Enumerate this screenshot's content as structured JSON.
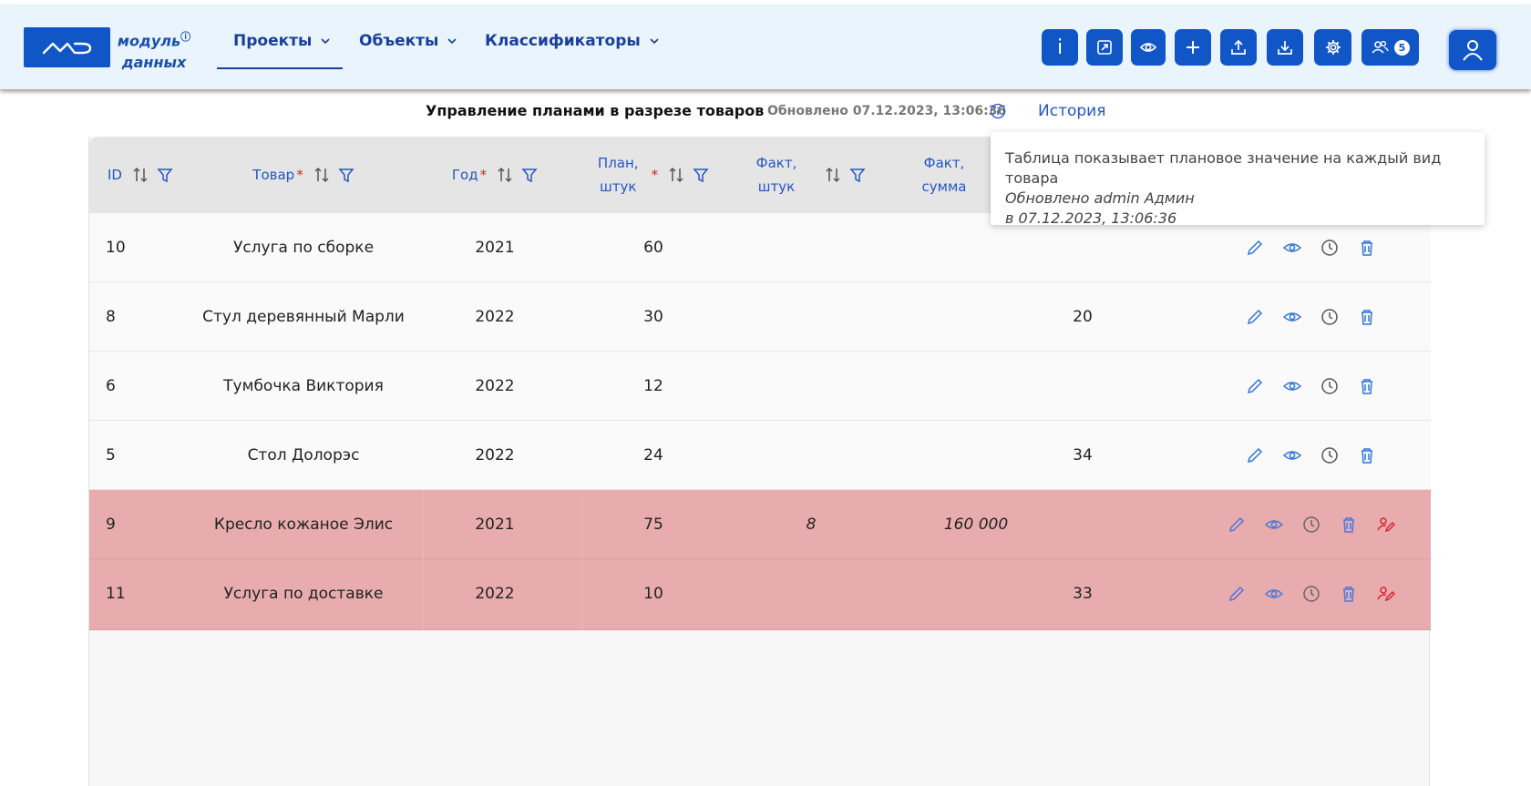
{
  "logo": {
    "line1": "модуль",
    "line2": "данных",
    "info": "i"
  },
  "nav": [
    {
      "label": "Проекты"
    },
    {
      "label": "Объекты"
    },
    {
      "label": "Классификаторы"
    }
  ],
  "toolbar": {
    "i_label": "i",
    "users_badge": "5"
  },
  "page": {
    "title": "Управление планами в разрезе товаров",
    "updated": "Обновлено 07.12.2023, 13:06:36",
    "history": "История"
  },
  "table": {
    "headers": {
      "id": "ID",
      "product": "Товар",
      "year": "Год",
      "plan_l1": "План,",
      "plan_l2": "штук",
      "fact_qty_l1": "Факт,",
      "fact_qty_l2": "штук",
      "fact_sum_l1": "Факт,",
      "fact_sum_l2": "сумма",
      "required_mark": "*"
    },
    "rows": [
      {
        "id": "10",
        "product": "Услуга по сборке",
        "year": "2021",
        "plan": "60",
        "fact_qty": "",
        "fact_sum": "",
        "extra": ""
      },
      {
        "id": "8",
        "product": "Стул деревянный Марли",
        "year": "2022",
        "plan": "30",
        "fact_qty": "",
        "fact_sum": "",
        "extra": "20"
      },
      {
        "id": "6",
        "product": "Тумбочка Виктория",
        "year": "2022",
        "plan": "12",
        "fact_qty": "",
        "fact_sum": "",
        "extra": ""
      },
      {
        "id": "5",
        "product": "Стол Долорэс",
        "year": "2022",
        "plan": "24",
        "fact_qty": "",
        "fact_sum": "",
        "extra": "34"
      },
      {
        "id": "9",
        "product": "Кресло кожаное Элис",
        "year": "2021",
        "plan": "75",
        "fact_qty": "8",
        "fact_sum": "160 000",
        "extra": ""
      },
      {
        "id": "11",
        "product": "Услуга по доставке",
        "year": "2022",
        "plan": "10",
        "fact_qty": "",
        "fact_sum": "",
        "extra": "33"
      }
    ]
  },
  "tooltip": {
    "line1": "Таблица показывает плановое значение на каждый вид товара",
    "line2": "Обновлено admin Админ",
    "line3": "в 07.12.2023, 13:06:36"
  },
  "colors": {
    "brand": "#1056c6",
    "header_bg": "#e9f4fc",
    "row_highlight": "#e8acae",
    "accent_text": "#2356c4",
    "required": "#e0201f"
  }
}
